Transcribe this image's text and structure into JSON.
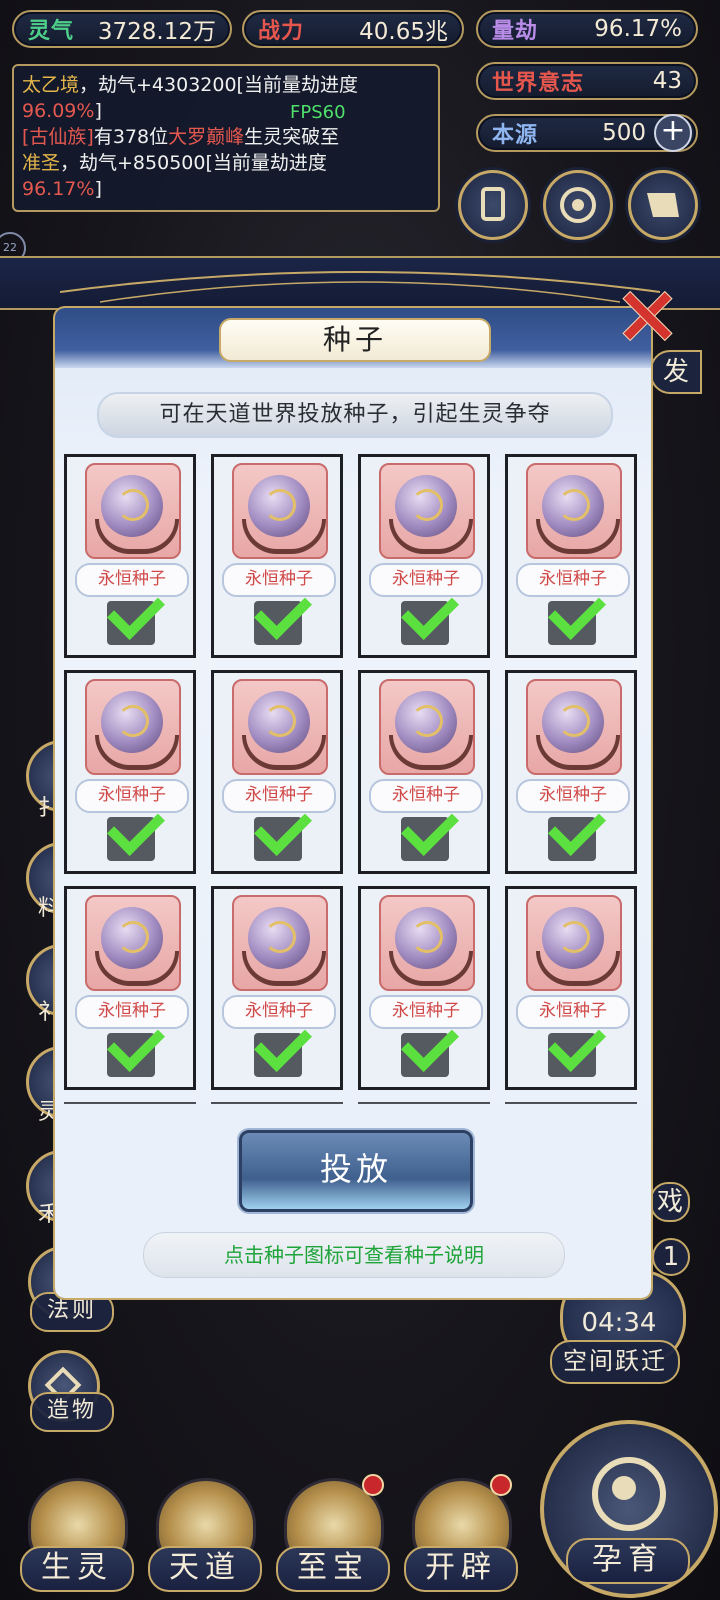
{
  "stats": {
    "lingqi": {
      "label": "灵气",
      "value": "3728.12万",
      "color": "#4ed08a"
    },
    "zhanli": {
      "label": "战力",
      "value": "40.65兆",
      "color": "#e5564d"
    },
    "liangjie": {
      "label": "量劫",
      "value": "96.17%",
      "color": "#b98ce8"
    },
    "shijie": {
      "label": "世界意志",
      "value": "43",
      "color": "#e5564d"
    },
    "benyuan": {
      "label": "本源",
      "value": "500",
      "color": "#8fb6f0"
    }
  },
  "log": {
    "line1_realm": "太乙境",
    "line1_text": "，劫气+4303200[当前量劫进度",
    "line1_pct": "96.09%",
    "line1_end": "]",
    "line2_clan": "[古仙族]",
    "line2_text": "有378位",
    "line2_rank": "大罗巅峰",
    "line2_text2": "生灵突破至",
    "line2_target": "准圣",
    "line2_text3": "，劫气+850500[当前量劫进度",
    "line2_pct": "96.17%",
    "line2_end": "]"
  },
  "fps": "FPS60",
  "partial_labels": {
    "right_top": "发",
    "right_mid": "戏",
    "right_num": "1",
    "left_cut": "22",
    "side1": "扌",
    "side2": "料",
    "side3": "礻",
    "side4": "灵",
    "side5": "禾"
  },
  "side": {
    "faze": "法则",
    "zaowu": "造物",
    "timer": "04:34",
    "kongjian": "空间跃迁"
  },
  "dialog": {
    "title": "种子",
    "subtitle": "可在天道世界投放种子，引起生灵争夺",
    "deploy": "投放",
    "hint": "点击种子图标可查看种子说明"
  },
  "seeds": [
    {
      "name": "永恒种子",
      "checked": true
    },
    {
      "name": "永恒种子",
      "checked": true
    },
    {
      "name": "永恒种子",
      "checked": true
    },
    {
      "name": "永恒种子",
      "checked": true
    },
    {
      "name": "永恒种子",
      "checked": true
    },
    {
      "name": "永恒种子",
      "checked": true
    },
    {
      "name": "永恒种子",
      "checked": true
    },
    {
      "name": "永恒种子",
      "checked": true
    },
    {
      "name": "永恒种子",
      "checked": true
    },
    {
      "name": "永恒种子",
      "checked": true
    },
    {
      "name": "永恒种子",
      "checked": true
    },
    {
      "name": "永恒种子",
      "checked": true
    }
  ],
  "nav": {
    "shengling": "生灵",
    "tiandao": "天道",
    "zhibao": "至宝",
    "kaipi": "开辟",
    "yunyu": "孕育"
  },
  "icons": [
    "card-icon",
    "portal-icon",
    "scroll-icon",
    "plus-icon",
    "close-icon",
    "check-icon",
    "seed-icon"
  ]
}
